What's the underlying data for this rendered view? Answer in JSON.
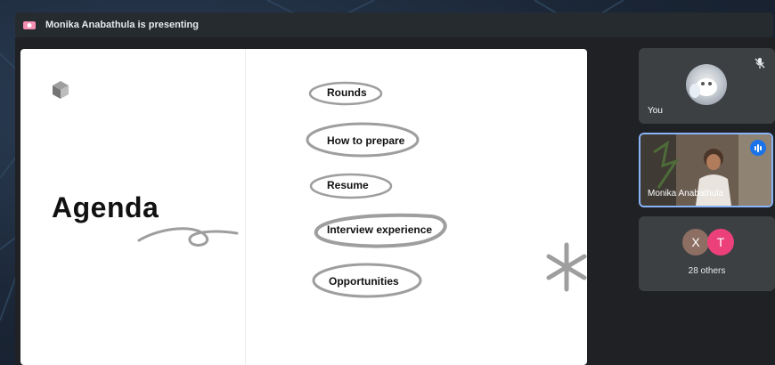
{
  "banner": {
    "presenting_text": "Monika Anabathula is presenting"
  },
  "slide": {
    "title": "Agenda",
    "items": [
      {
        "label": "Rounds"
      },
      {
        "label": "How to prepare"
      },
      {
        "label": "Resume"
      },
      {
        "label": "Interview experience"
      },
      {
        "label": "Opportunities"
      }
    ]
  },
  "participants": {
    "self": {
      "name": "You"
    },
    "presenter": {
      "name": "Monika Anabathula"
    },
    "others": {
      "avatars": [
        "X",
        "T"
      ],
      "label": "28 others",
      "colors": [
        "#8d6e63",
        "#ec407a"
      ]
    }
  },
  "colors": {
    "active_speaker_border": "#8ab4f8",
    "speaking_badge": "#1a73e8"
  }
}
